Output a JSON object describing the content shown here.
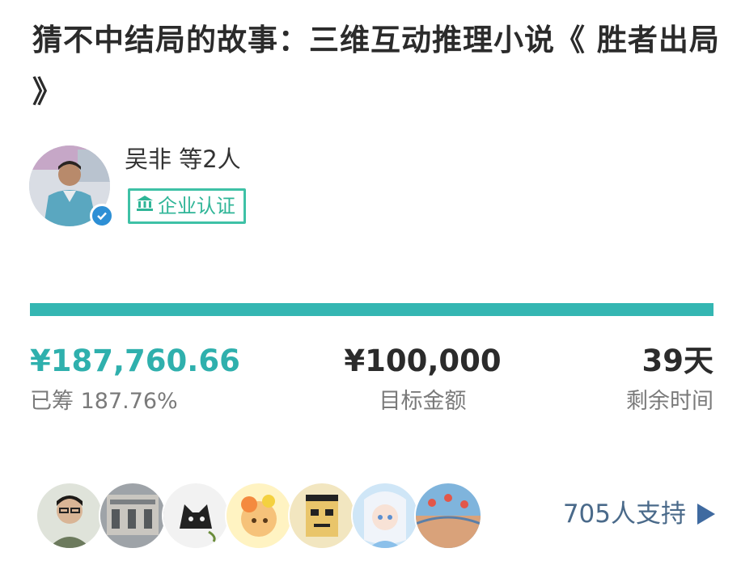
{
  "project": {
    "title": "猜不中结局的故事：三维互动推理小说《 胜者出局 》"
  },
  "author": {
    "name": "吴非 等2人",
    "verified_icon": "check-icon",
    "badge_icon": "bank-icon",
    "badge_label": "企业认证"
  },
  "funding": {
    "progress_fraction": 1.0,
    "raised_value": "¥187,760.66",
    "raised_label": "已筹 187.76%",
    "goal_value": "¥100,000",
    "goal_label": "目标金额",
    "days_value": "39天",
    "days_label": "剩余时间",
    "accent_color": "#34b6b2"
  },
  "backers": {
    "support_label": "705人支持",
    "arrow_icon": "play-arrow-icon"
  }
}
